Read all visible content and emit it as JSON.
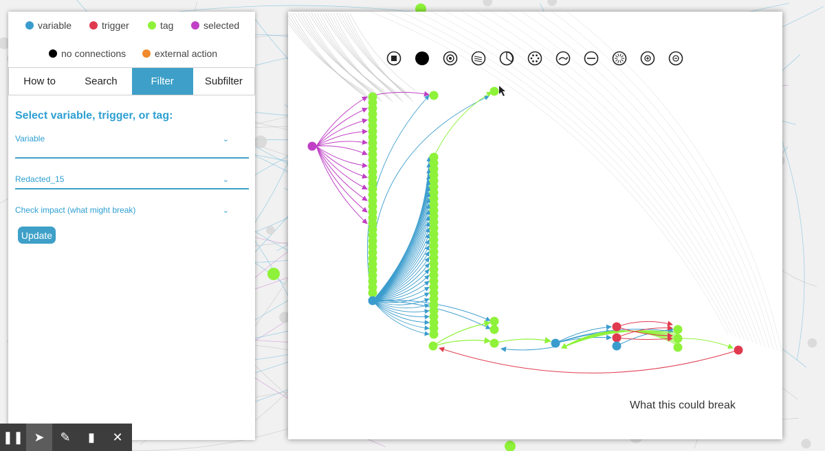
{
  "legend": {
    "variable": "variable",
    "trigger": "trigger",
    "tag": "tag",
    "selected": "selected",
    "no_connections": "no connections",
    "external_action": "external action",
    "colors": {
      "variable": "#3a9ccd",
      "trigger": "#e03a4e",
      "tag": "#8ff23a",
      "selected": "#c03fc6",
      "no_connections": "#000000",
      "external_action": "#f08a2c"
    }
  },
  "tabs": [
    "How to",
    "Search",
    "Filter",
    "Subfilter"
  ],
  "active_tab": "Filter",
  "filter": {
    "heading": "Select variable, trigger, or tag:",
    "type_select": "Variable",
    "item_select": "Redacted_15",
    "mode_select": "Check impact (what might break)",
    "update_label": "Update"
  },
  "graph": {
    "caption": "What this could break",
    "toolbar_icons": [
      "center-icon",
      "fill-icon",
      "target-icon",
      "scatter-icon",
      "pie-icon",
      "cluster-icon",
      "curve-icon",
      "minus-icon",
      "burst-icon",
      "zoom-in-icon",
      "zoom-out-icon"
    ]
  },
  "bottom_toolbar": [
    "pause-icon",
    "pointer-icon",
    "pen-icon",
    "eraser-icon",
    "close-icon"
  ]
}
